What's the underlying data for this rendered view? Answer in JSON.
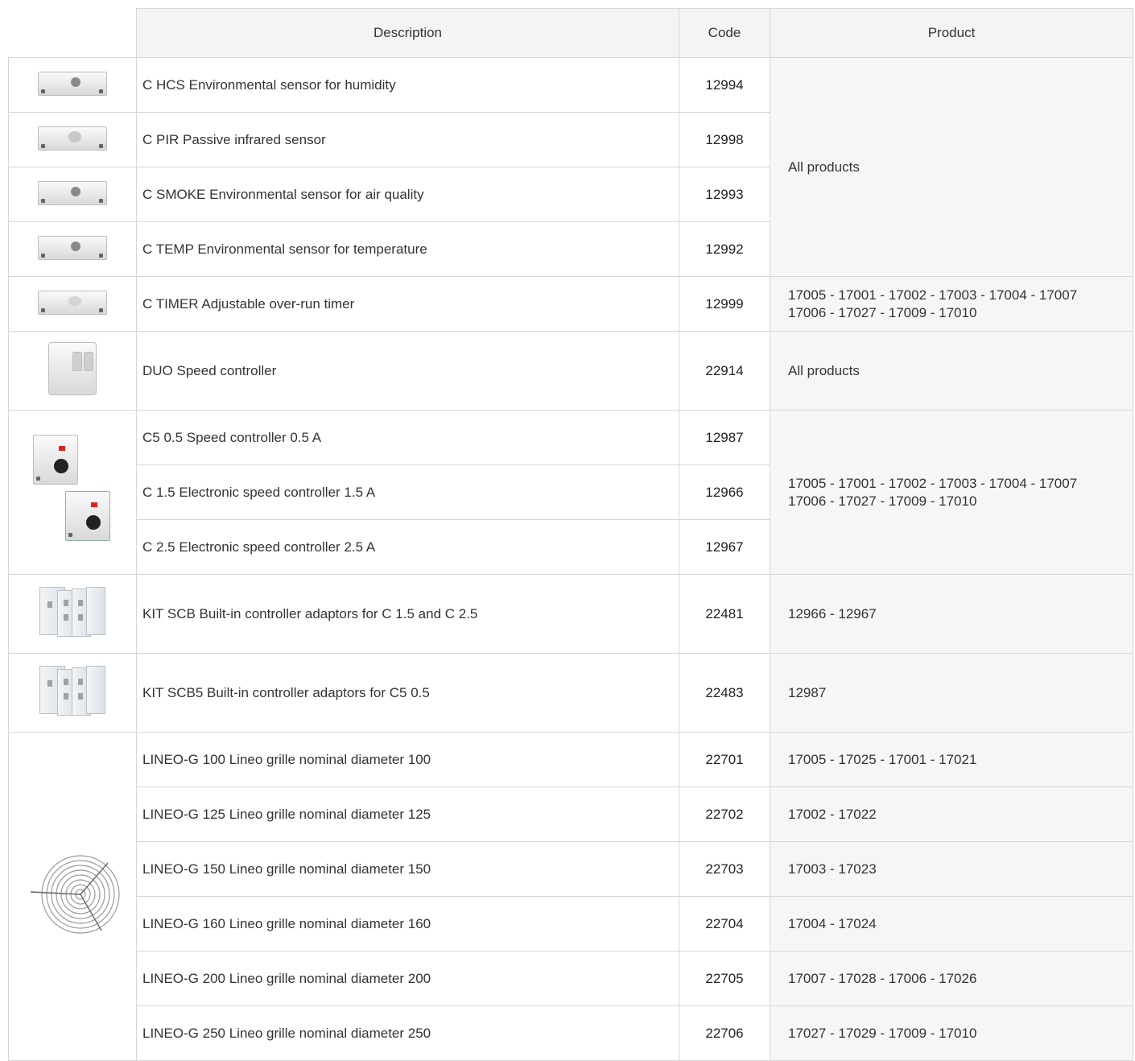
{
  "headers": {
    "description": "Description",
    "code": "Code",
    "product": "Product"
  },
  "rows": [
    {
      "description": "C HCS Environmental sensor for humidity",
      "code": "12994",
      "icon": "sensor-box"
    },
    {
      "description": "C PIR Passive infrared sensor",
      "code": "12998",
      "icon": "sensor-box"
    },
    {
      "description": "C SMOKE Environmental sensor for air quality",
      "code": "12993",
      "icon": "sensor-box"
    },
    {
      "description": "C TEMP Environmental sensor for temperature",
      "code": "12992",
      "icon": "sensor-box"
    },
    {
      "description": "C TIMER Adjustable over-run timer",
      "code": "12999",
      "icon": "sensor-box"
    },
    {
      "description": "DUO Speed controller",
      "code": "22914",
      "icon": "duo-controller"
    },
    {
      "description": "C5 0.5 Speed controller 0.5 A",
      "code": "12987",
      "icon": "speed-controller"
    },
    {
      "description": "C 1.5 Electronic speed controller 1.5 A",
      "code": "12966",
      "icon": "speed-controller"
    },
    {
      "description": "C 2.5 Electronic speed controller 2.5 A",
      "code": "12967",
      "icon": "speed-controller"
    },
    {
      "description": "KIT SCB Built-in controller adaptors for C 1.5 and C 2.5",
      "code": "22481",
      "icon": "adaptor-kit"
    },
    {
      "description": "KIT SCB5 Built-in controller adaptors for C5 0.5",
      "code": "22483",
      "icon": "adaptor-kit"
    },
    {
      "description": "LINEO-G 100 Lineo grille nominal diameter 100",
      "code": "22701",
      "icon": "grille"
    },
    {
      "description": "LINEO-G 125 Lineo grille nominal diameter 125",
      "code": "22702",
      "icon": "grille"
    },
    {
      "description": "LINEO-G 150 Lineo grille nominal diameter 150",
      "code": "22703",
      "icon": "grille"
    },
    {
      "description": "LINEO-G 160 Lineo grille nominal diameter 160",
      "code": "22704",
      "icon": "grille"
    },
    {
      "description": "LINEO-G 200 Lineo grille nominal diameter 200",
      "code": "22705",
      "icon": "grille"
    },
    {
      "description": "LINEO-G 250 Lineo grille nominal diameter 250",
      "code": "22706",
      "icon": "grille"
    }
  ],
  "products": {
    "sensors": "All products",
    "timer_line1": "17005 - 17001 - 17002 - 17003 - 17004 - 17007",
    "timer_line2": "17006 - 17027 - 17009 - 17010",
    "duo": "All products",
    "controllers_line1": "17005 - 17001 - 17002 - 17003 - 17004 - 17007",
    "controllers_line2": "17006 - 17027 - 17009 - 17010",
    "kit_scb": "12966 - 12967",
    "kit_scb5": "12987",
    "lineo_100": "17005 - 17025 - 17001 - 17021",
    "lineo_125": "17002 - 17022",
    "lineo_150": "17003 - 17023",
    "lineo_160": "17004 - 17024",
    "lineo_200": "17007 - 17028 - 17006 - 17026",
    "lineo_250": "17027 - 17029 - 17009 - 17010"
  }
}
